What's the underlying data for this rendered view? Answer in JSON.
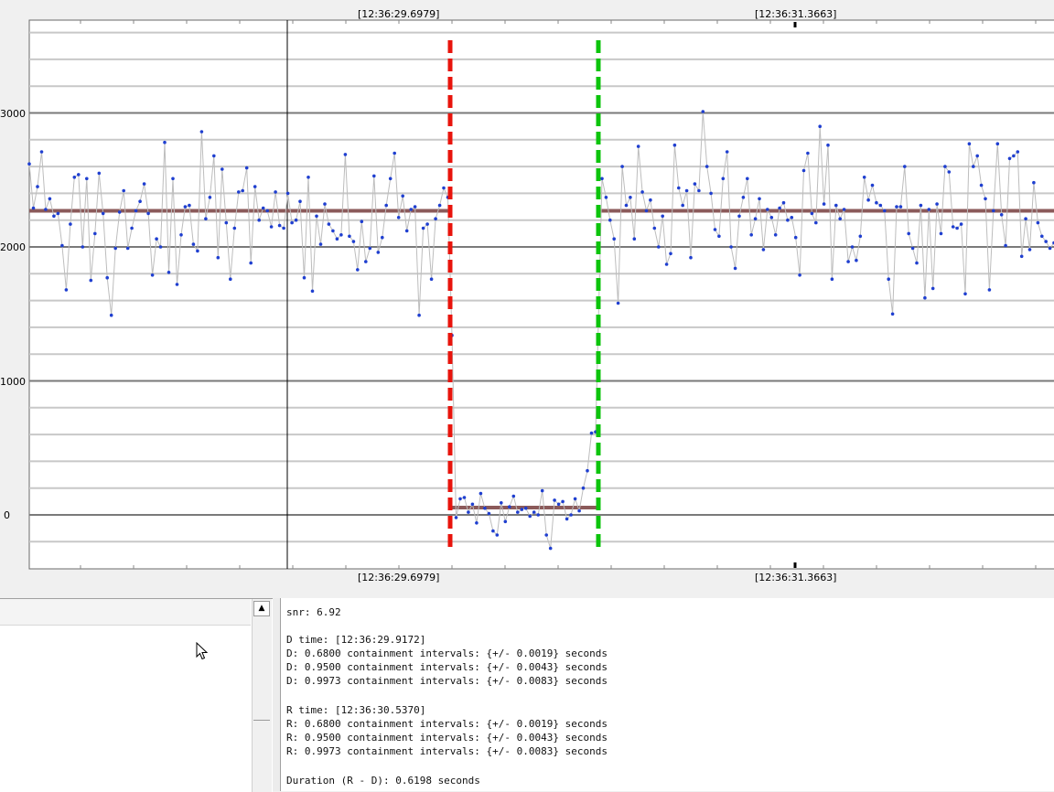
{
  "plot": {
    "top_time_labels": [
      "[12:36:29.6979]",
      "[12:36:31.3663]"
    ],
    "bottom_time_labels": [
      "[12:36:29.6979]",
      "[12:36:31.3663]"
    ],
    "y_tick_labels": [
      "3000",
      "2000",
      "1000",
      "0"
    ],
    "colors": {
      "background": "#ffffff",
      "points": "#1f3fd0",
      "trace": "#bdbdbd",
      "mean_level": "#8b5a5a",
      "d_marker": "#e8140c",
      "r_marker": "#0cc40c"
    }
  },
  "chart_data": {
    "type": "scatter",
    "title": "",
    "xlabel": "",
    "ylabel": "",
    "ylim": [
      -420,
      3700
    ],
    "y_ticks": [
      3000,
      2000,
      1000,
      0
    ],
    "x_time_ticks": [
      "[12:36:29.6979]",
      "[12:36:31.3663]"
    ],
    "markers": [
      {
        "name": "D",
        "time": "12:36:29.9172",
        "color": "#e8140c"
      },
      {
        "name": "R",
        "time": "12:36:30.5370",
        "color": "#0cc40c"
      }
    ],
    "levels": [
      {
        "from_index": 0,
        "to_index": 52,
        "value": 2270
      },
      {
        "from_index": 53,
        "to_index": 70,
        "value": 55
      },
      {
        "from_index": 71,
        "to_index": 171,
        "value": 2270
      }
    ],
    "series": [
      {
        "values": [
          2620,
          2290,
          2450,
          2710,
          2280,
          2360,
          2230,
          2250,
          2010,
          1680,
          2170,
          2520,
          2540,
          2000,
          2510,
          1750,
          2100,
          2550,
          2250,
          1770,
          1490,
          1990,
          2260,
          2420,
          1990,
          2140,
          2270,
          2340,
          2470,
          2250,
          1790,
          2060,
          2000,
          2780,
          1810,
          2510,
          1720,
          2090,
          2300,
          2310,
          2020,
          1970,
          2860,
          2210,
          2370,
          2680,
          1920,
          2580,
          2180,
          1760,
          2140,
          2410,
          2420,
          2590,
          1880,
          2450,
          2200,
          2290,
          2270,
          2150,
          2410,
          2160,
          2140,
          2400,
          2180,
          2200,
          2340,
          1770,
          2520,
          1670,
          2230,
          2020,
          2320,
          2170,
          2120,
          2060,
          2090,
          2690,
          2080,
          2040,
          1830,
          2190,
          1890,
          1990,
          2530,
          1960,
          2070,
          2310,
          2510,
          2700,
          2220,
          2380,
          2120,
          2280,
          2300,
          1490,
          2140,
          2170,
          1760,
          2210,
          2310,
          2440,
          2370,
          1340,
          -20,
          120,
          130,
          20,
          80,
          -60,
          160,
          50,
          10,
          -120,
          -150,
          90,
          -50,
          60,
          140,
          20,
          40,
          50,
          -10,
          20,
          0,
          180,
          -150,
          -250,
          110,
          80,
          100,
          -30,
          0,
          120,
          30,
          200,
          330,
          610,
          620
        ],
        "note_excluded": ""
      }
    ]
  },
  "right_values": [
    2510,
    2370,
    2200,
    2060,
    1580,
    2600,
    2310,
    2370,
    2060,
    2750,
    2410,
    2270,
    2350,
    2140,
    2000,
    2230,
    1870,
    1950,
    2760,
    2440,
    2310,
    2420,
    1920,
    2470,
    2420,
    3010,
    2600,
    2400,
    2130,
    2080,
    2510,
    2710,
    2000,
    1840,
    2230,
    2370,
    2510,
    2090,
    2210,
    2360,
    1980,
    2280,
    2220,
    2090,
    2290,
    2330,
    2200,
    2220,
    2070,
    1790,
    2570,
    2700,
    2250,
    2180,
    2900,
    2320,
    2760,
    1760,
    2310,
    2210,
    2280,
    1890,
    2000,
    1900,
    2080,
    2520,
    2350,
    2460,
    2330,
    2310,
    2270,
    1760,
    1500,
    2300,
    2300,
    2600,
    2100,
    1990,
    1880,
    2310,
    1620,
    2280,
    1690,
    2320,
    2100,
    2600,
    2560,
    2150,
    2140,
    2170,
    1650,
    2770,
    2600,
    2680,
    2460,
    2360,
    1680,
    2270,
    2770,
    2240,
    2010,
    2660,
    2680,
    2710,
    1930,
    2210,
    1980,
    2480,
    2180,
    2080,
    2040,
    1990,
    2030
  ],
  "left_panel": {
    "scroll_up_glyph": "▲"
  },
  "output": {
    "lines": [
      "snr: 6.92",
      "",
      "D time: [12:36:29.9172]",
      "D: 0.6800 containment intervals: {+/- 0.0019} seconds",
      "D: 0.9500 containment intervals: {+/- 0.0043} seconds",
      "D: 0.9973 containment intervals: {+/- 0.0083} seconds",
      "",
      "R time: [12:36:30.5370]",
      "R: 0.6800 containment intervals: {+/- 0.0019} seconds",
      "R: 0.9500 containment intervals: {+/- 0.0043} seconds",
      "R: 0.9973 containment intervals: {+/- 0.0083} seconds",
      "",
      "Duration (R - D): 0.6198 seconds"
    ]
  }
}
